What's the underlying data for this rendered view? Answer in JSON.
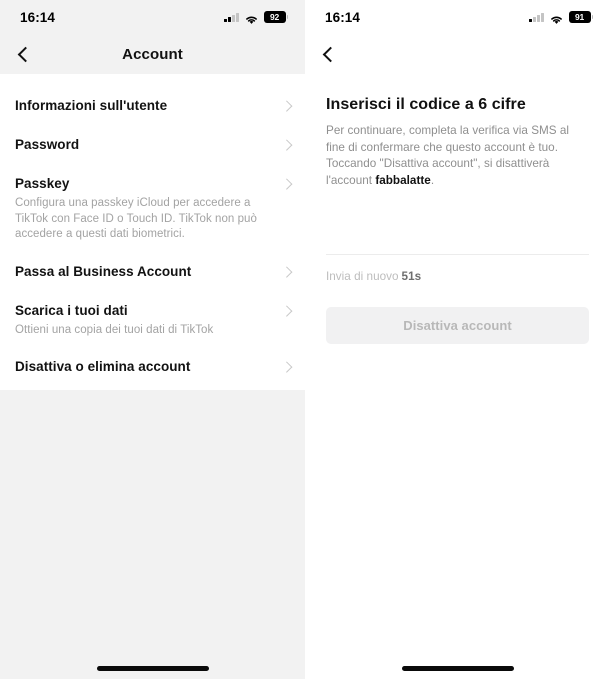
{
  "left_screen": {
    "status_bar": {
      "time": "16:14",
      "signal_icon": "cellular-signal-icon",
      "wifi_icon": "wifi-icon",
      "battery_level": "92"
    },
    "nav": {
      "back_icon": "chevron-left-icon",
      "title": "Account"
    },
    "rows": [
      {
        "title": "Informazioni sull'utente",
        "subtitle": "",
        "chevron_icon": "chevron-right-icon"
      },
      {
        "title": "Password",
        "subtitle": "",
        "chevron_icon": "chevron-right-icon"
      },
      {
        "title": "Passkey",
        "subtitle": "Configura una passkey iCloud per accedere a TikTok con Face ID o Touch ID. TikTok non può accedere a questi dati biometrici.",
        "chevron_icon": "chevron-right-icon"
      },
      {
        "title": "Passa al Business Account",
        "subtitle": "",
        "chevron_icon": "chevron-right-icon"
      },
      {
        "title": "Scarica i tuoi dati",
        "subtitle": "Ottieni una copia dei tuoi dati di TikTok",
        "chevron_icon": "chevron-right-icon"
      },
      {
        "title": "Disattiva o elimina account",
        "subtitle": "",
        "chevron_icon": "chevron-right-icon"
      }
    ]
  },
  "right_screen": {
    "status_bar": {
      "time": "16:14",
      "signal_icon": "cellular-signal-icon",
      "wifi_icon": "wifi-icon",
      "battery_level": "91"
    },
    "nav": {
      "back_icon": "chevron-left-icon",
      "title": ""
    },
    "verification": {
      "title": "Inserisci il codice a 6 cifre",
      "description_part1": "Per continuare, completa la verifica via SMS al fine di confermare che questo account è tuo. Toccando \"Disattiva account\", si disattiverà l'account ",
      "description_username": "fabbalatte",
      "description_part2": ".",
      "code_value": "",
      "code_placeholder": "",
      "resend_label": "Invia di nuovo",
      "resend_timer": "51s",
      "submit_label": "Disattiva account"
    }
  },
  "colors": {
    "page_background": "#f2f2f2",
    "card_background": "#ffffff",
    "primary_text": "#121212",
    "secondary_text": "#8f8f8f",
    "chevron": "#c8c8c8",
    "disabled_button_bg": "#f1f1f2",
    "disabled_button_text": "#b8b8b8"
  }
}
